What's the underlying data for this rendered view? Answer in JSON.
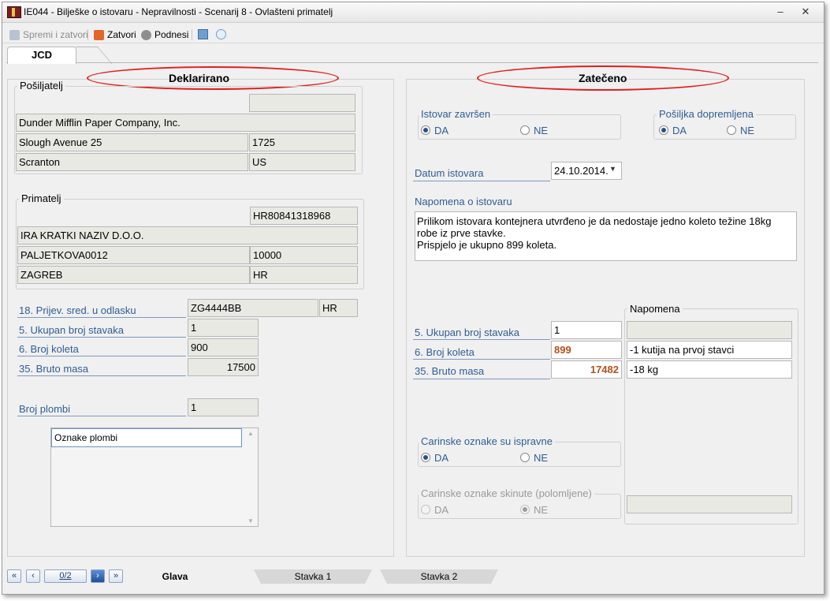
{
  "window": {
    "title": "IE044 - Bilješke o istovaru - Nepravilnosti - Scenarij 8 - Ovlašteni primatelj",
    "minimize": "–",
    "close": "✕"
  },
  "toolbar": {
    "save_close": "Spremi i zatvori",
    "close": "Zatvori",
    "submit": "Podnesi"
  },
  "tabs": {
    "active": "JCD"
  },
  "declared": {
    "header": "Deklarirano",
    "sender": {
      "label": "Pošiljatelj",
      "id": "",
      "name": "Dunder Mifflin Paper Company, Inc.",
      "street": "Slough Avenue 25",
      "postcode": "1725",
      "city": "Scranton",
      "country": "US"
    },
    "receiver": {
      "label": "Primatelj",
      "id": "HR80841318968",
      "name": "IRA KRATKI NAZIV D.O.O.",
      "street": "PALJETKOVA0012",
      "postcode": "10000",
      "city": "ZAGREB",
      "country": "HR"
    },
    "transport": {
      "label": "18. Prijev. sred. u odlasku",
      "value": "ZG4444BB",
      "country": "HR"
    },
    "total_items": {
      "label": "5. Ukupan broj stavaka",
      "value": "1"
    },
    "packages": {
      "label": "6. Broj koleta",
      "value": "900"
    },
    "gross_mass": {
      "label": "35. Bruto masa",
      "value": "17500"
    },
    "seals_count": {
      "label": "Broj plombi",
      "value": "1"
    },
    "seals_list": {
      "header": "Oznake plombi"
    }
  },
  "found": {
    "header": "Zatečeno",
    "unloading_done": {
      "label": "Istovar završen",
      "yes": "DA",
      "no": "NE",
      "selected": "DA"
    },
    "shipment_delivered": {
      "label": "Pošiljka dopremljena",
      "yes": "DA",
      "no": "NE",
      "selected": "DA"
    },
    "unloading_date": {
      "label": "Datum istovara",
      "value": "24.10.2014."
    },
    "unloading_note": {
      "label": "Napomena o istovaru",
      "line1": "Prilikom istovara kontejnera utvrđeno je da nedostaje jedno koleto težine 18kg",
      "line2": "robe iz prve stavke.",
      "line3": "Prispjelo je ukupno 899  koleta."
    },
    "note_header": "Napomena",
    "total_items": {
      "label": "5. Ukupan broj stavaka",
      "value": "1",
      "note": ""
    },
    "packages": {
      "label": "6. Broj koleta",
      "value": "899",
      "note": "-1 kutija na prvoj stavci"
    },
    "gross_mass": {
      "label": "35. Bruto masa",
      "value": "17482",
      "note": "-18 kg"
    },
    "customs_marks_ok": {
      "label": "Carinske oznake su ispravne",
      "yes": "DA",
      "no": "NE",
      "selected": "DA"
    },
    "customs_marks_removed": {
      "label": "Carinske oznake skinute (polomljene)",
      "yes": "DA",
      "no": "NE",
      "selected": "NE",
      "note": ""
    }
  },
  "pager": {
    "value": "0/2"
  },
  "bottom_tabs": [
    "Glava",
    "Stavka 1",
    "Stavka 2"
  ],
  "colors": {
    "accent_blue": "#2f5d93",
    "highlight_orange": "#b4501a",
    "oval_red": "#e21e1e"
  }
}
